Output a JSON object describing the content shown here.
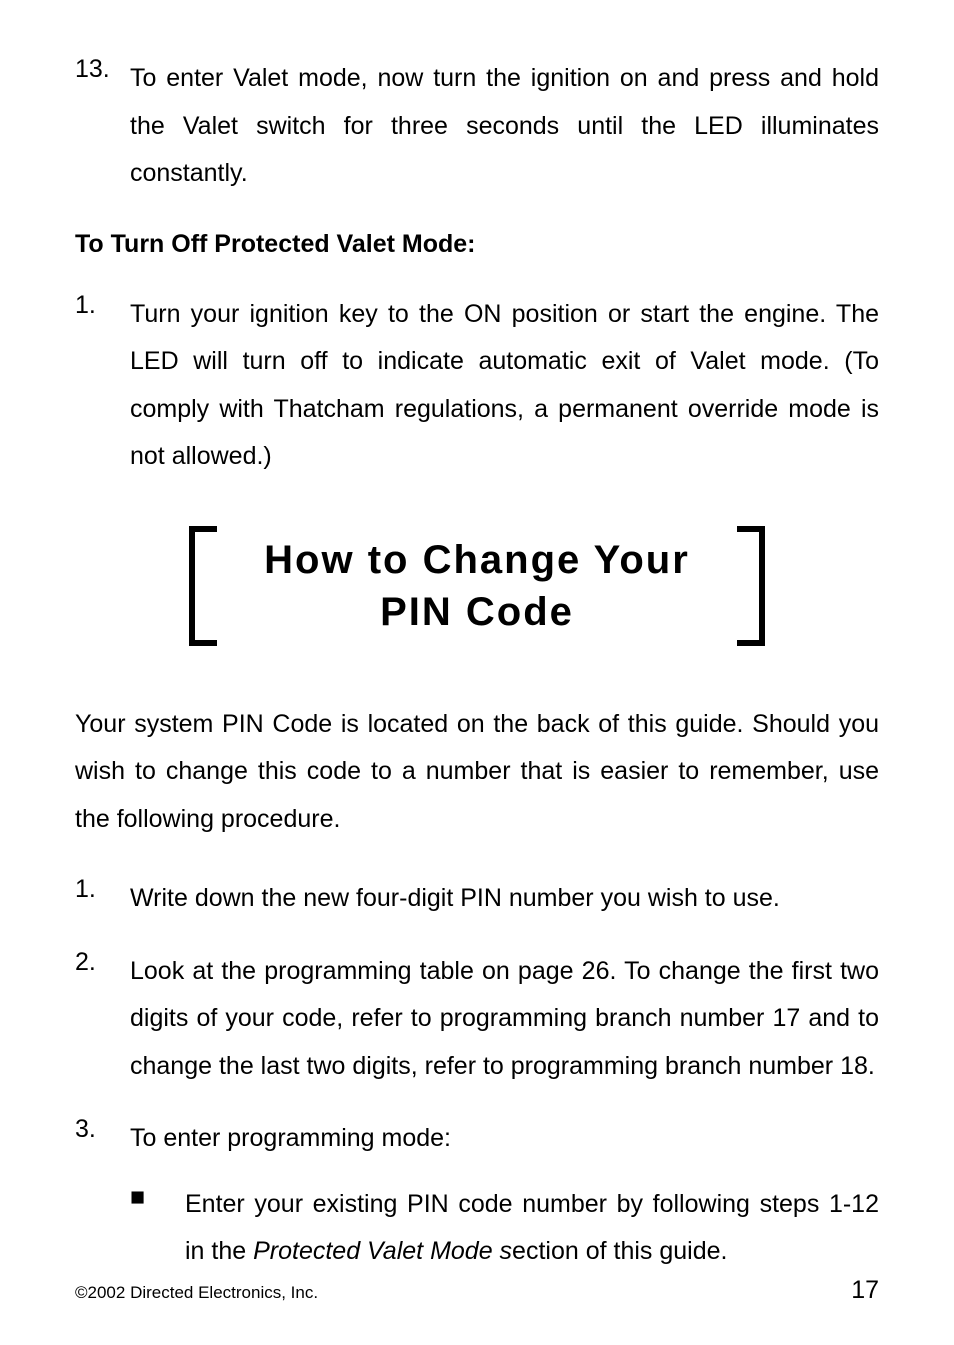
{
  "item13": {
    "num": "13.",
    "text": "To enter Valet mode, now turn the ignition on and press and hold the Valet switch for three seconds until the LED illuminates constantly."
  },
  "subheading": "To Turn Off Protected Valet Mode:",
  "turnoff_item1": {
    "num": "1.",
    "text": "Turn your ignition key to the ON position or start the engine. The LED will turn off to indicate automatic exit of Valet mode. (To comply with Thatcham regulations, a permanent override mode is not allowed.)"
  },
  "section_title_line1": "How to Change Your",
  "section_title_line2": "PIN Code",
  "intro": "Your system PIN Code is located on the back of this guide. Should you wish to change this code to a number that is easier to remember, use the following procedure.",
  "pin_items": [
    {
      "num": "1.",
      "text": "Write down the new four-digit PIN number you wish to use."
    },
    {
      "num": "2.",
      "text": "Look at the programming table on page 26. To change the first two digits of your code, refer to programming branch number 17 and to change the last two digits, refer to programming branch number 18."
    },
    {
      "num": "3.",
      "text": "To enter programming mode:"
    }
  ],
  "sub_bullet": {
    "marker": "■",
    "pre": "Enter your existing PIN code number by following steps 1-12 in the ",
    "italic": "Protected Valet Mode s",
    "post": "ection of this guide."
  },
  "footer_left": "©2002 Directed Electronics, Inc.",
  "footer_right": "17"
}
